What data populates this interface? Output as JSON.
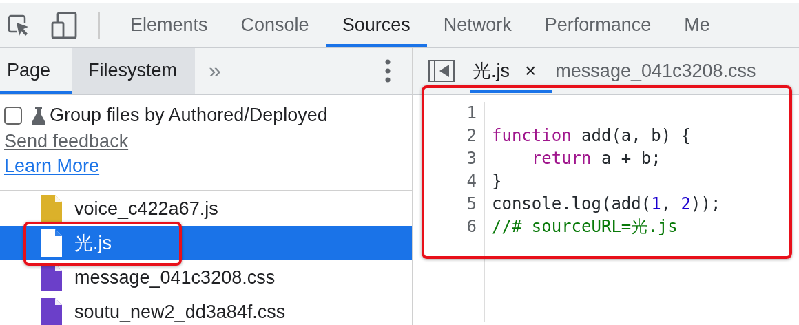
{
  "main_tabs": [
    {
      "label": "Elements",
      "selected": false
    },
    {
      "label": "Console",
      "selected": false
    },
    {
      "label": "Sources",
      "selected": true
    },
    {
      "label": "Network",
      "selected": false
    },
    {
      "label": "Performance",
      "selected": false
    },
    {
      "label": "Me",
      "selected": false
    }
  ],
  "navigator": {
    "tabs": [
      {
        "label": "Page",
        "selected": true
      },
      {
        "label": "Filesystem",
        "selected": false
      }
    ],
    "more": "»",
    "group_option": {
      "label": "Group files by Authored/Deployed",
      "checked": false
    },
    "links": [
      "Send feedback",
      "Learn More"
    ],
    "files": [
      {
        "name": "voice_c422a67.js",
        "color": "#dbb12a",
        "selected": false
      },
      {
        "name": "光.js",
        "color": "#ffffff",
        "selected": true
      },
      {
        "name": "message_041c3208.css",
        "color": "#6b3fc9",
        "selected": false
      },
      {
        "name": "soutu_new2_dd3a84f.css",
        "color": "#6b3fc9",
        "selected": false
      }
    ]
  },
  "editor": {
    "tabs": [
      {
        "label": "光.js",
        "selected": true,
        "closable": true
      },
      {
        "label": "message_041c3208.css",
        "selected": false,
        "closable": false
      }
    ],
    "close": "×",
    "lines": [
      {
        "number": "1"
      },
      {
        "number": "2",
        "tokens": [
          {
            "kind": "keyword",
            "text": "function"
          },
          {
            "kind": "plain",
            "text": " add(a, b) {"
          }
        ]
      },
      {
        "number": "3",
        "tokens": [
          {
            "kind": "keyword",
            "text": "    return"
          },
          {
            "kind": "plain",
            "text": " a + b;"
          }
        ]
      },
      {
        "number": "4",
        "tokens": [
          {
            "kind": "plain",
            "text": "}"
          }
        ]
      },
      {
        "number": "5",
        "tokens": [
          {
            "kind": "plain",
            "text": "console.log(add("
          },
          {
            "kind": "number",
            "text": "1"
          },
          {
            "kind": "plain",
            "text": ", "
          },
          {
            "kind": "number",
            "text": "2"
          },
          {
            "kind": "plain",
            "text": "));"
          }
        ]
      },
      {
        "number": "6",
        "tokens": [
          {
            "kind": "comment",
            "text": "//# sourceURL=光.js"
          }
        ]
      }
    ]
  }
}
